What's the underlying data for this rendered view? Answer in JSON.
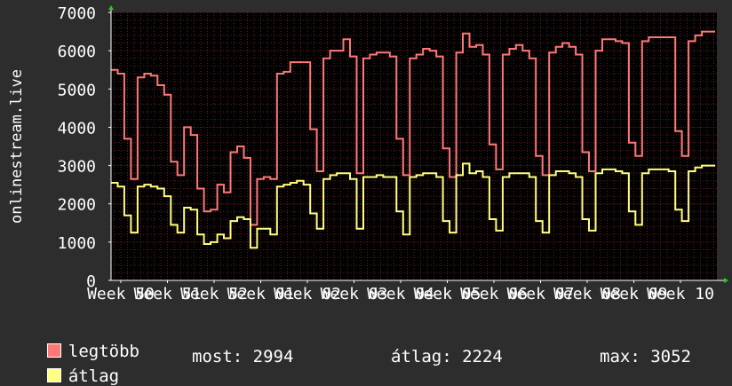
{
  "chart_data": {
    "type": "line",
    "ylabel": "onlinestream.live",
    "ylim": [
      0,
      7000
    ],
    "yticks": [
      0,
      1000,
      2000,
      3000,
      4000,
      5000,
      6000,
      7000
    ],
    "xtick_labels": [
      "Week 50",
      "Week 51",
      "Week 52",
      "Week 01",
      "Week 02",
      "Week 03",
      "Week 04",
      "Week 05",
      "Week 06",
      "Week 07",
      "Week 08",
      "Week 09",
      "Week 10"
    ],
    "grid": true,
    "colors": {
      "background": "#2d2d2d",
      "plot_bg": "#000000",
      "grid": "#5a1e1e",
      "axis": "#ffffff",
      "arrow": "#22cc22"
    },
    "series": [
      {
        "name": "legtöbb",
        "color": "#ff7878",
        "values": [
          5500,
          5400,
          3700,
          2650,
          5300,
          5400,
          5350,
          5100,
          4850,
          3100,
          2750,
          4000,
          3800,
          2400,
          1800,
          1850,
          2500,
          2300,
          3350,
          3500,
          3200,
          1450,
          2650,
          2700,
          2650,
          5400,
          5450,
          5700,
          5700,
          5700,
          3950,
          2850,
          5800,
          6000,
          6000,
          6300,
          5850,
          2800,
          5800,
          5900,
          5950,
          5950,
          5850,
          3700,
          2750,
          5800,
          5900,
          6050,
          6000,
          5850,
          3450,
          2700,
          5950,
          6450,
          6100,
          6150,
          5900,
          3550,
          2900,
          5900,
          6050,
          6150,
          6000,
          5800,
          3250,
          2750,
          5950,
          6100,
          6200,
          6100,
          5900,
          3350,
          2850,
          6000,
          6300,
          6300,
          6250,
          6200,
          3600,
          3250,
          6250,
          6350,
          6350,
          6350,
          6350,
          3900,
          3250,
          6250,
          6400,
          6500,
          6500
        ]
      },
      {
        "name": "átlag",
        "color": "#ffff80",
        "values": [
          2550,
          2450,
          1700,
          1250,
          2450,
          2500,
          2450,
          2400,
          2200,
          1450,
          1250,
          1900,
          1850,
          1200,
          950,
          1000,
          1200,
          1100,
          1550,
          1650,
          1600,
          850,
          1350,
          1350,
          1200,
          2450,
          2500,
          2550,
          2600,
          2500,
          1750,
          1350,
          2650,
          2750,
          2800,
          2800,
          2650,
          1350,
          2700,
          2700,
          2750,
          2700,
          2700,
          1800,
          1200,
          2700,
          2750,
          2800,
          2800,
          2700,
          1550,
          1250,
          2750,
          3050,
          2800,
          2850,
          2700,
          1600,
          1300,
          2700,
          2800,
          2800,
          2800,
          2700,
          1550,
          1250,
          2750,
          2850,
          2850,
          2800,
          2700,
          1600,
          1300,
          2800,
          2900,
          2900,
          2850,
          2800,
          1800,
          1450,
          2800,
          2900,
          2900,
          2900,
          2850,
          1850,
          1550,
          2850,
          2950,
          3000,
          3000
        ]
      }
    ]
  },
  "legend": {
    "max_label": "legtöbb",
    "avg_label": "átlag",
    "now_text": "most: 2994",
    "avg_text": "átlag: 2224",
    "max_text": "max: 3052"
  }
}
